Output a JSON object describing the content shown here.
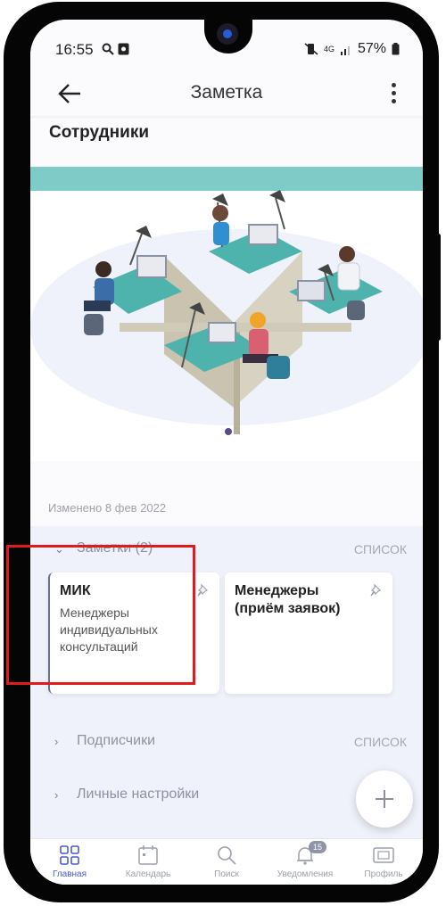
{
  "status_bar": {
    "time": "16:55",
    "network": "4G",
    "battery": "57%"
  },
  "app_bar": {
    "title": "Заметка",
    "back_icon": "arrow-left-icon",
    "menu_icon": "more-vertical-icon"
  },
  "page": {
    "title": "Сотрудники",
    "modified": "Изменено 8 фев 2022"
  },
  "notes_section": {
    "label": "Заметки (2)",
    "link": "СПИСОК",
    "cards": [
      {
        "title": "МИК",
        "description": "Менеджеры индивидуальных консультаций",
        "pin_icon": "pin-icon"
      },
      {
        "title": "Менеджеры (приём заявок)",
        "description": "",
        "pin_icon": "pin-icon"
      }
    ]
  },
  "subscribers_section": {
    "label": "Подписчики",
    "link": "СПИСОК"
  },
  "settings_section": {
    "label": "Личные настройки"
  },
  "fab": {
    "icon": "plus-icon"
  },
  "bottom_nav": [
    {
      "label": "Главная",
      "icon": "grid-icon",
      "active": true
    },
    {
      "label": "Календарь",
      "icon": "calendar-icon",
      "active": false
    },
    {
      "label": "Поиск",
      "icon": "search-icon",
      "active": false
    },
    {
      "label": "Уведомления",
      "icon": "bell-icon",
      "badge": "15",
      "active": false
    },
    {
      "label": "Профиль",
      "icon": "profile-card-icon",
      "active": false
    }
  ],
  "colors": {
    "accent": "#4a5bd0",
    "highlight": "#e01b1b",
    "panel_bg": "#eff2fa",
    "illustration_band": "#7fcbc7"
  }
}
